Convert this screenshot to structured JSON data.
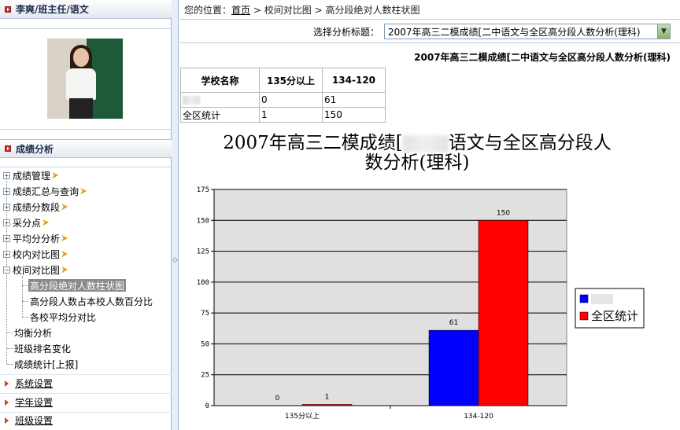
{
  "sidebar": {
    "user_title": "李爽/班主任/语文",
    "score_title": "成绩分析",
    "tree": [
      {
        "label": "成绩管理",
        "expanded": false
      },
      {
        "label": "成绩汇总与查询",
        "expanded": false
      },
      {
        "label": "成绩分数段",
        "expanded": false
      },
      {
        "label": "采分点",
        "expanded": false
      },
      {
        "label": "平均分分析",
        "expanded": false
      },
      {
        "label": "校内对比图",
        "expanded": false
      },
      {
        "label": "校间对比图",
        "expanded": true
      }
    ],
    "children": [
      {
        "label": "高分段绝对人数柱状图",
        "selected": true
      },
      {
        "label": "高分段人数占本校人数百分比",
        "selected": false
      },
      {
        "label": "各校平均分对比",
        "selected": false
      }
    ],
    "leaves": [
      "均衡分析",
      "班级排名变化",
      "成绩统计[上报]"
    ],
    "sections": [
      "系统设置",
      "学年设置",
      "班级设置"
    ]
  },
  "breadcrumb": {
    "prefix": "您的位置：",
    "home": "首页",
    "sep1": ">",
    "item1": "校间对比图",
    "sep2": ">",
    "item2": "高分段绝对人数柱状图"
  },
  "selector": {
    "label": "选择分析标题：",
    "value": "2007年高三二模成绩[二中语文与全区高分段人数分析(理科)"
  },
  "report_title": "2007年高三二模成绩[二中语文与全区高分段人数分析(理科)",
  "table": {
    "headers": [
      "学校名称",
      "135分以上",
      "134-120"
    ],
    "rows": [
      {
        "name": "",
        "v1": "0",
        "v2": "61"
      },
      {
        "name": "全区统计",
        "v1": "1",
        "v2": "150"
      }
    ]
  },
  "chart_title_parts": [
    "2007年高三二模成绩[",
    "语文与全区高分段人",
    "数分析(理科)"
  ],
  "colors": {
    "series1": "#0000ff",
    "series2": "#ff0000",
    "plot_bg": "#e0e0e0"
  },
  "chart_data": {
    "type": "bar",
    "categories": [
      "135分以上",
      "134-120"
    ],
    "series": [
      {
        "name": "",
        "values": [
          0,
          61
        ]
      },
      {
        "name": "全区统计",
        "values": [
          1,
          150
        ]
      }
    ],
    "ylim": [
      0,
      175
    ],
    "yticks": [
      "0",
      "25",
      "50",
      "75",
      "100",
      "125",
      "150",
      "175"
    ],
    "grid": true,
    "legend": "right"
  }
}
